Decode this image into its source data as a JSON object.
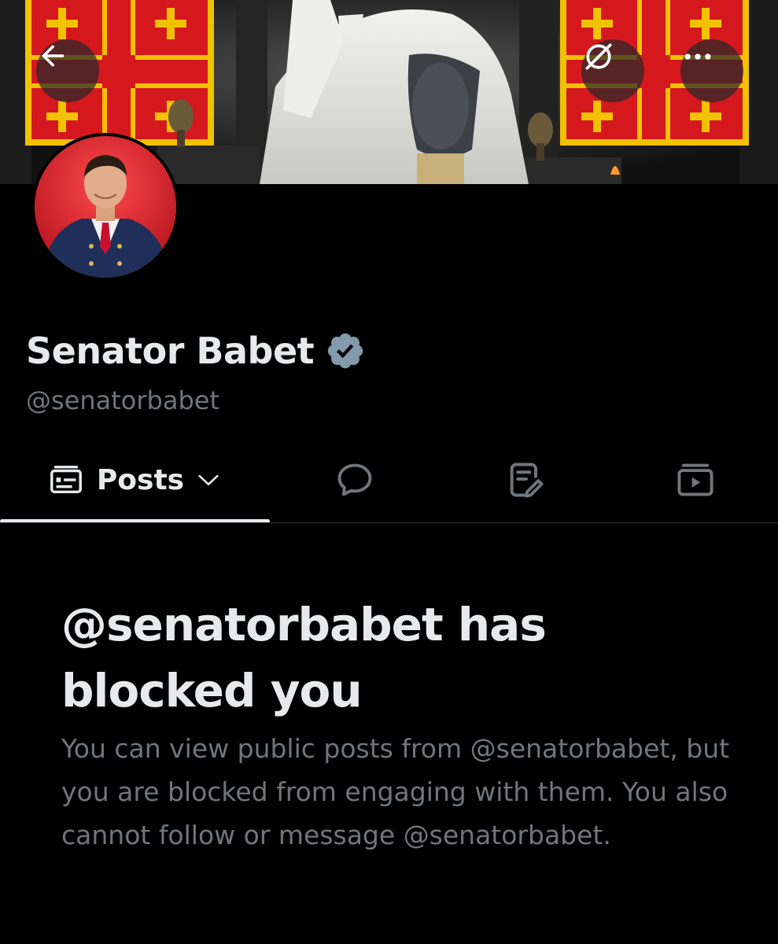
{
  "profile": {
    "display_name": "Senator Babet",
    "handle": "@senatorbabet",
    "verified": true,
    "verified_color": "#829aab"
  },
  "header_buttons": {
    "back_icon": "arrow-left-icon",
    "hidden_icon": "eye-off-icon",
    "more_icon": "more-horizontal-icon"
  },
  "tabs": [
    {
      "label": "Posts",
      "icon": "posts-list-icon",
      "selected": true,
      "has_dropdown": true
    },
    {
      "label": "",
      "icon": "reply-bubble-icon",
      "selected": false
    },
    {
      "label": "",
      "icon": "article-edit-icon",
      "selected": false
    },
    {
      "label": "",
      "icon": "media-play-icon",
      "selected": false
    }
  ],
  "blocked": {
    "title": "@senatorbabet has blocked you",
    "body": "You can view public posts from @senatorbabet, but you are blocked from engaging with them. You also cannot follow or message @senatorbabet."
  },
  "colors": {
    "background": "#000000",
    "primary_text": "#e7e9ea",
    "secondary_text": "#71767b",
    "cross_red": "#d4181e",
    "cross_gold": "#f2c200"
  }
}
